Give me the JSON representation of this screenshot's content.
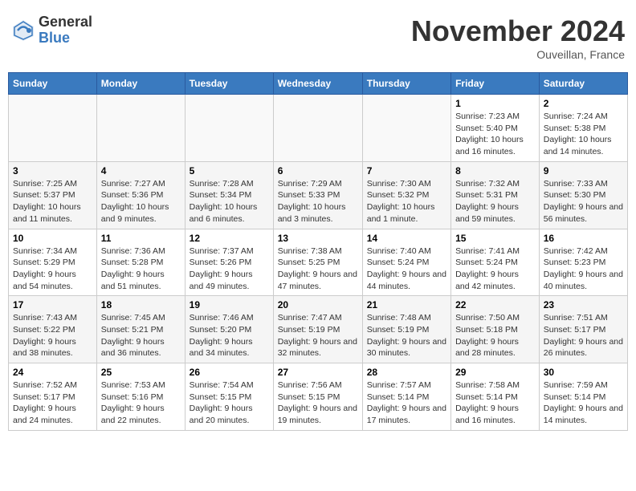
{
  "logo": {
    "general": "General",
    "blue": "Blue"
  },
  "title": "November 2024",
  "location": "Ouveillan, France",
  "days_of_week": [
    "Sunday",
    "Monday",
    "Tuesday",
    "Wednesday",
    "Thursday",
    "Friday",
    "Saturday"
  ],
  "weeks": [
    [
      {
        "day": "",
        "info": ""
      },
      {
        "day": "",
        "info": ""
      },
      {
        "day": "",
        "info": ""
      },
      {
        "day": "",
        "info": ""
      },
      {
        "day": "",
        "info": ""
      },
      {
        "day": "1",
        "info": "Sunrise: 7:23 AM\nSunset: 5:40 PM\nDaylight: 10 hours and 16 minutes."
      },
      {
        "day": "2",
        "info": "Sunrise: 7:24 AM\nSunset: 5:38 PM\nDaylight: 10 hours and 14 minutes."
      }
    ],
    [
      {
        "day": "3",
        "info": "Sunrise: 7:25 AM\nSunset: 5:37 PM\nDaylight: 10 hours and 11 minutes."
      },
      {
        "day": "4",
        "info": "Sunrise: 7:27 AM\nSunset: 5:36 PM\nDaylight: 10 hours and 9 minutes."
      },
      {
        "day": "5",
        "info": "Sunrise: 7:28 AM\nSunset: 5:34 PM\nDaylight: 10 hours and 6 minutes."
      },
      {
        "day": "6",
        "info": "Sunrise: 7:29 AM\nSunset: 5:33 PM\nDaylight: 10 hours and 3 minutes."
      },
      {
        "day": "7",
        "info": "Sunrise: 7:30 AM\nSunset: 5:32 PM\nDaylight: 10 hours and 1 minute."
      },
      {
        "day": "8",
        "info": "Sunrise: 7:32 AM\nSunset: 5:31 PM\nDaylight: 9 hours and 59 minutes."
      },
      {
        "day": "9",
        "info": "Sunrise: 7:33 AM\nSunset: 5:30 PM\nDaylight: 9 hours and 56 minutes."
      }
    ],
    [
      {
        "day": "10",
        "info": "Sunrise: 7:34 AM\nSunset: 5:29 PM\nDaylight: 9 hours and 54 minutes."
      },
      {
        "day": "11",
        "info": "Sunrise: 7:36 AM\nSunset: 5:28 PM\nDaylight: 9 hours and 51 minutes."
      },
      {
        "day": "12",
        "info": "Sunrise: 7:37 AM\nSunset: 5:26 PM\nDaylight: 9 hours and 49 minutes."
      },
      {
        "day": "13",
        "info": "Sunrise: 7:38 AM\nSunset: 5:25 PM\nDaylight: 9 hours and 47 minutes."
      },
      {
        "day": "14",
        "info": "Sunrise: 7:40 AM\nSunset: 5:24 PM\nDaylight: 9 hours and 44 minutes."
      },
      {
        "day": "15",
        "info": "Sunrise: 7:41 AM\nSunset: 5:24 PM\nDaylight: 9 hours and 42 minutes."
      },
      {
        "day": "16",
        "info": "Sunrise: 7:42 AM\nSunset: 5:23 PM\nDaylight: 9 hours and 40 minutes."
      }
    ],
    [
      {
        "day": "17",
        "info": "Sunrise: 7:43 AM\nSunset: 5:22 PM\nDaylight: 9 hours and 38 minutes."
      },
      {
        "day": "18",
        "info": "Sunrise: 7:45 AM\nSunset: 5:21 PM\nDaylight: 9 hours and 36 minutes."
      },
      {
        "day": "19",
        "info": "Sunrise: 7:46 AM\nSunset: 5:20 PM\nDaylight: 9 hours and 34 minutes."
      },
      {
        "day": "20",
        "info": "Sunrise: 7:47 AM\nSunset: 5:19 PM\nDaylight: 9 hours and 32 minutes."
      },
      {
        "day": "21",
        "info": "Sunrise: 7:48 AM\nSunset: 5:19 PM\nDaylight: 9 hours and 30 minutes."
      },
      {
        "day": "22",
        "info": "Sunrise: 7:50 AM\nSunset: 5:18 PM\nDaylight: 9 hours and 28 minutes."
      },
      {
        "day": "23",
        "info": "Sunrise: 7:51 AM\nSunset: 5:17 PM\nDaylight: 9 hours and 26 minutes."
      }
    ],
    [
      {
        "day": "24",
        "info": "Sunrise: 7:52 AM\nSunset: 5:17 PM\nDaylight: 9 hours and 24 minutes."
      },
      {
        "day": "25",
        "info": "Sunrise: 7:53 AM\nSunset: 5:16 PM\nDaylight: 9 hours and 22 minutes."
      },
      {
        "day": "26",
        "info": "Sunrise: 7:54 AM\nSunset: 5:15 PM\nDaylight: 9 hours and 20 minutes."
      },
      {
        "day": "27",
        "info": "Sunrise: 7:56 AM\nSunset: 5:15 PM\nDaylight: 9 hours and 19 minutes."
      },
      {
        "day": "28",
        "info": "Sunrise: 7:57 AM\nSunset: 5:14 PM\nDaylight: 9 hours and 17 minutes."
      },
      {
        "day": "29",
        "info": "Sunrise: 7:58 AM\nSunset: 5:14 PM\nDaylight: 9 hours and 16 minutes."
      },
      {
        "day": "30",
        "info": "Sunrise: 7:59 AM\nSunset: 5:14 PM\nDaylight: 9 hours and 14 minutes."
      }
    ]
  ]
}
